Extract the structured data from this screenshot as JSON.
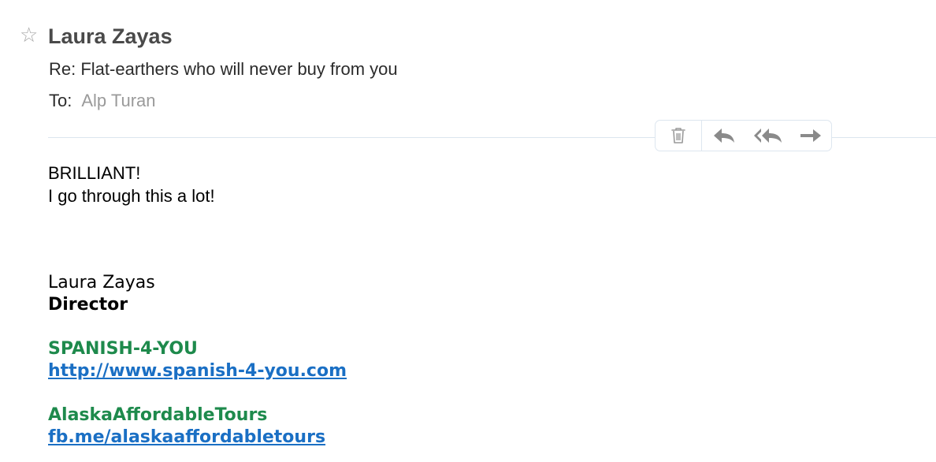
{
  "header": {
    "sender": "Laura Zayas",
    "subject": "Re: Flat-earthers who will never buy from you",
    "to_label": "To:",
    "to_value": "Alp Turan"
  },
  "toolbar": {
    "icons": [
      "trash-icon",
      "reply-icon",
      "reply-all-icon",
      "forward-icon"
    ]
  },
  "body": {
    "line1": "BRILLIANT!",
    "line2": "I go through this a lot!"
  },
  "signature": {
    "name": "Laura Zayas",
    "title": "Director",
    "company1": "SPANISH-4-YOU",
    "link1": "http://www.spanish-4-you.com",
    "company2": "AlaskaAffordableTours",
    "link2": "fb.me/alaskaaffordabletours"
  },
  "colors": {
    "accent_green": "#1e8a4c",
    "link_blue": "#1a6fc4",
    "muted_gray": "#9a9a9a"
  }
}
